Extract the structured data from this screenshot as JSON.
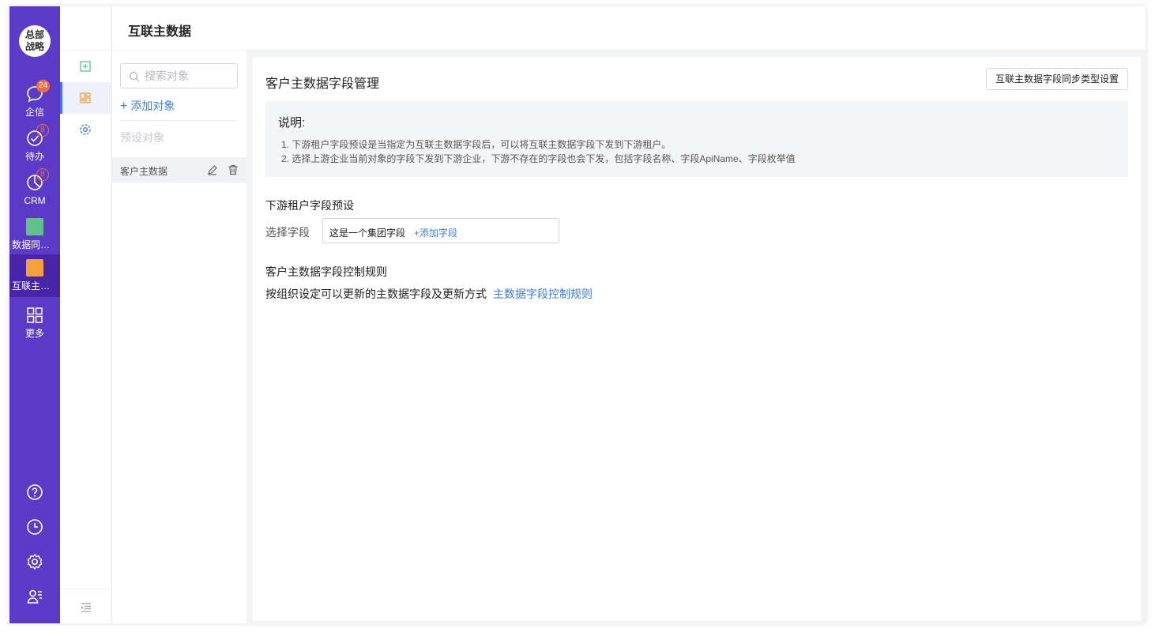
{
  "header": {
    "title": "互联主数据"
  },
  "nav": {
    "org": "总部\n战略",
    "items": [
      {
        "label": "企信",
        "badge": "24"
      },
      {
        "label": "待办",
        "badge": "8"
      },
      {
        "label": "CRM",
        "badge": "8"
      },
      {
        "label": "数据同步设置"
      },
      {
        "label": "互联主数据"
      },
      {
        "label": "更多"
      }
    ]
  },
  "objects": {
    "search_placeholder": "搜索对象",
    "add_label": "添加对象",
    "preset_label": "预设对象",
    "rows": [
      {
        "name": "客户主数据"
      }
    ]
  },
  "main": {
    "title": "客户主数据字段管理",
    "sync_button": "互联主数据字段同步类型设置",
    "note": {
      "title": "说明:",
      "lines": [
        "1. 下游租户字段预设是当指定为互联主数据字段后，可以将互联主数据字段下发到下游租户。",
        "2. 选择上游企业当前对象的字段下发到下游企业，下游不存在的字段也会下发，包括字段名称、字段ApiName、字段枚举值"
      ]
    },
    "preset_section": {
      "title": "下游租户字段预设",
      "select_label": "选择字段",
      "selected": "这是一个集团字段",
      "add_field": "+添加字段"
    },
    "rules_section": {
      "title": "客户主数据字段控制规则",
      "desc": "按组织设定可以更新的主数据字段及更新方式",
      "link": "主数据字段控制规则"
    }
  },
  "colors": {
    "nav_bg": "#5b3ac7",
    "accent": "#3b7ddc",
    "badge": "#f26b43"
  }
}
